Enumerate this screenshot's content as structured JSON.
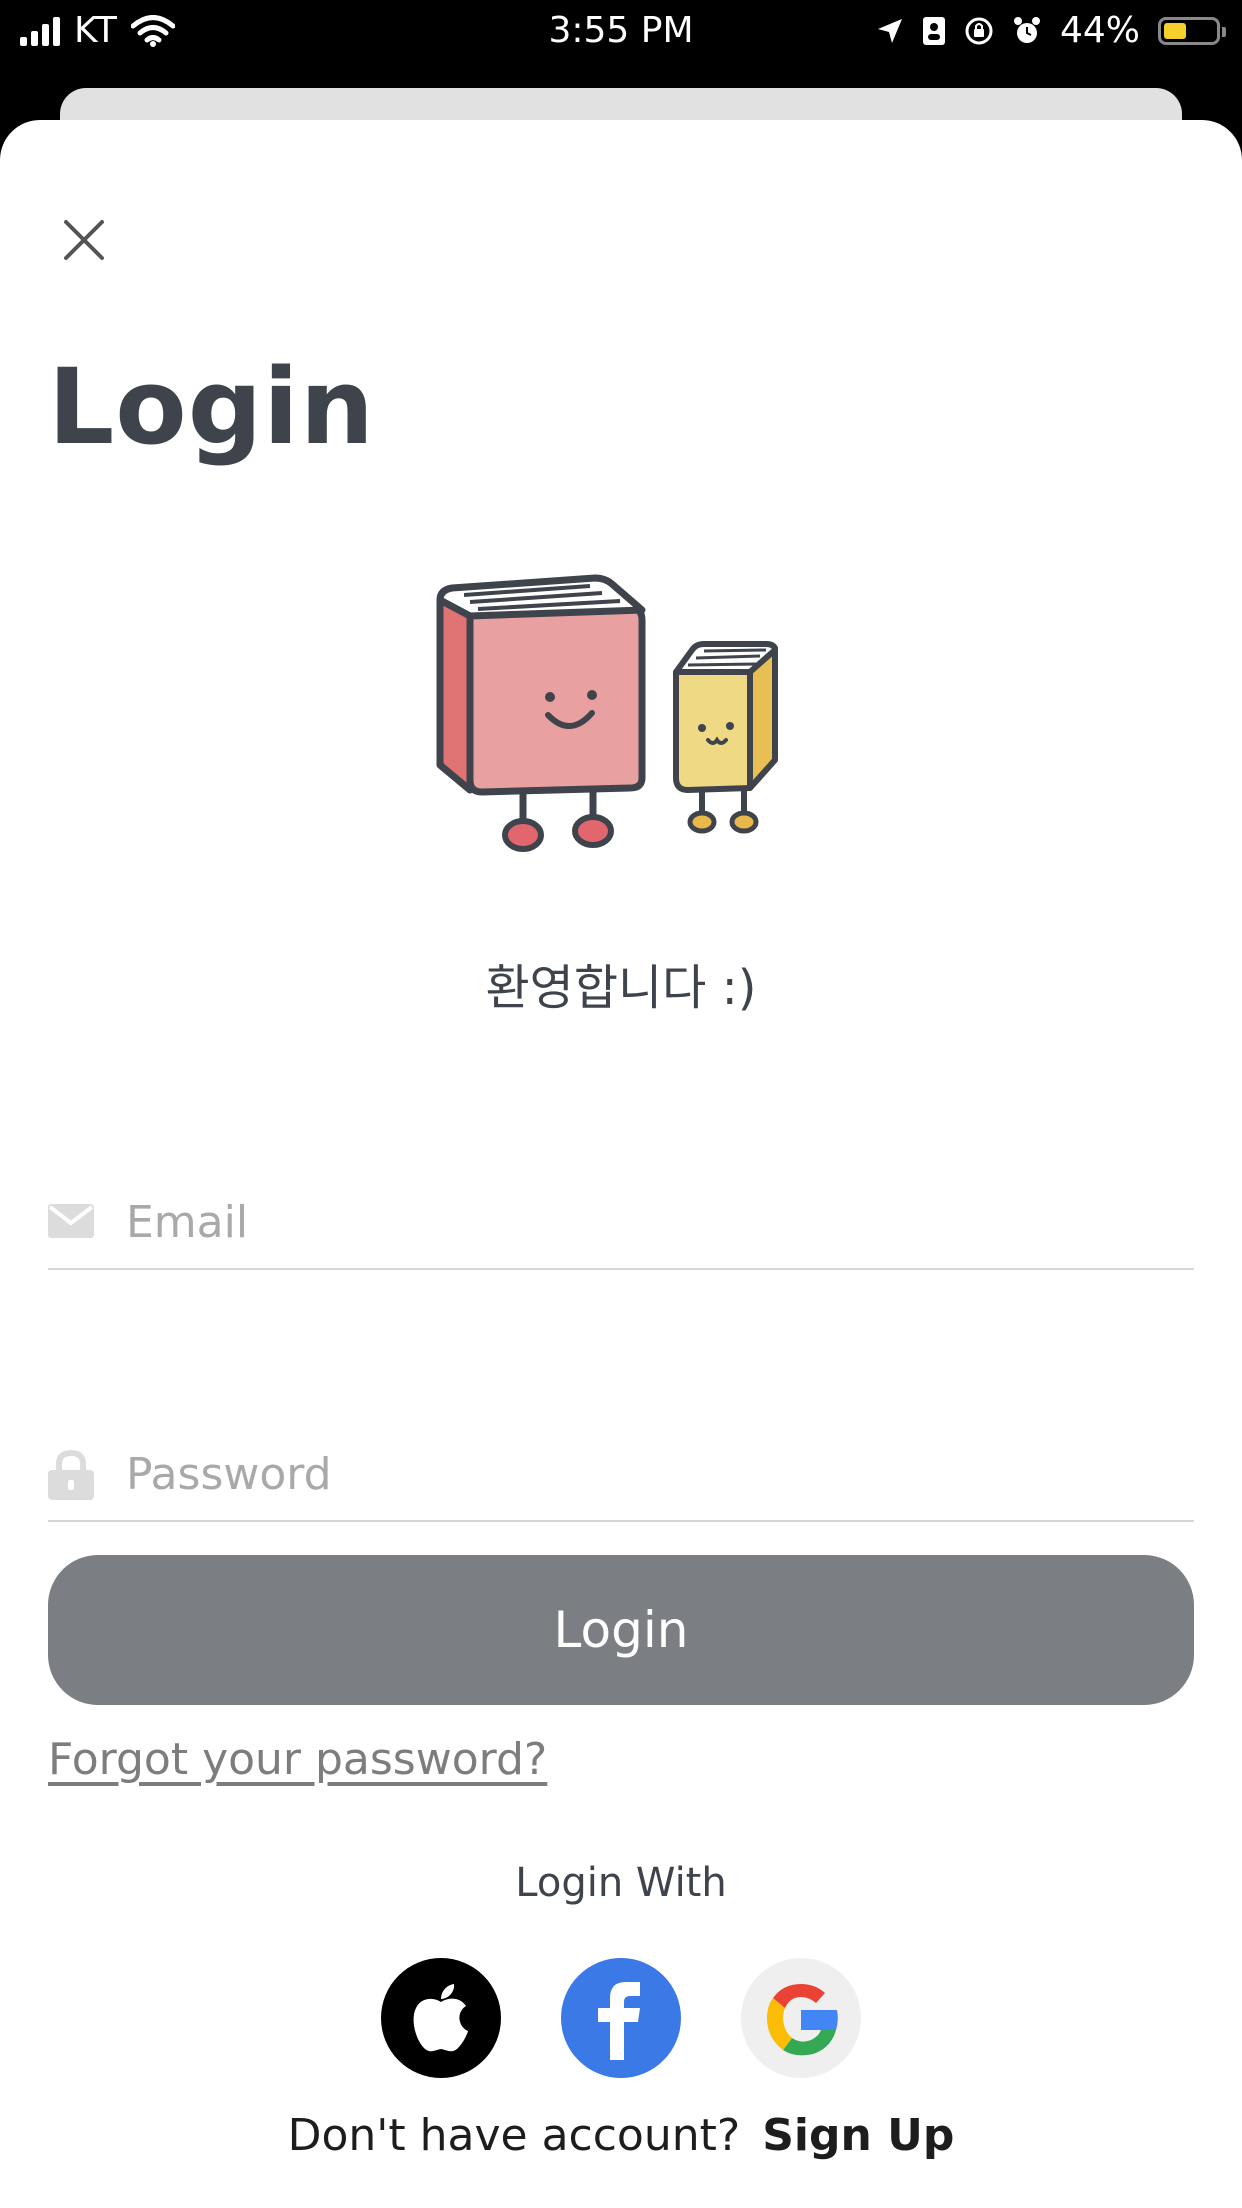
{
  "status_bar": {
    "carrier": "KT",
    "time": "3:55 PM",
    "battery_percent": "44%",
    "battery_level": 0.44,
    "icons": [
      "signal-icon",
      "wifi-icon",
      "location-icon",
      "contact-card-icon",
      "orientation-lock-icon",
      "alarm-icon",
      "battery-icon"
    ]
  },
  "header": {
    "close_icon": "close-icon",
    "title": "Login"
  },
  "welcome": "환영합니다 :)",
  "form": {
    "email_placeholder": "Email",
    "email_icon": "mail-icon",
    "password_placeholder": "Password",
    "password_icon": "lock-icon",
    "login_button": "Login",
    "forgot_password": "Forgot your password?"
  },
  "social": {
    "label": "Login With",
    "providers": [
      "apple",
      "facebook",
      "google"
    ]
  },
  "footer": {
    "prompt": "Don't have account?",
    "signup": "Sign Up"
  },
  "colors": {
    "title": "#3f444c",
    "button": "#7b7e83",
    "facebook": "#3b79e6",
    "battery": "#f6d02f"
  }
}
